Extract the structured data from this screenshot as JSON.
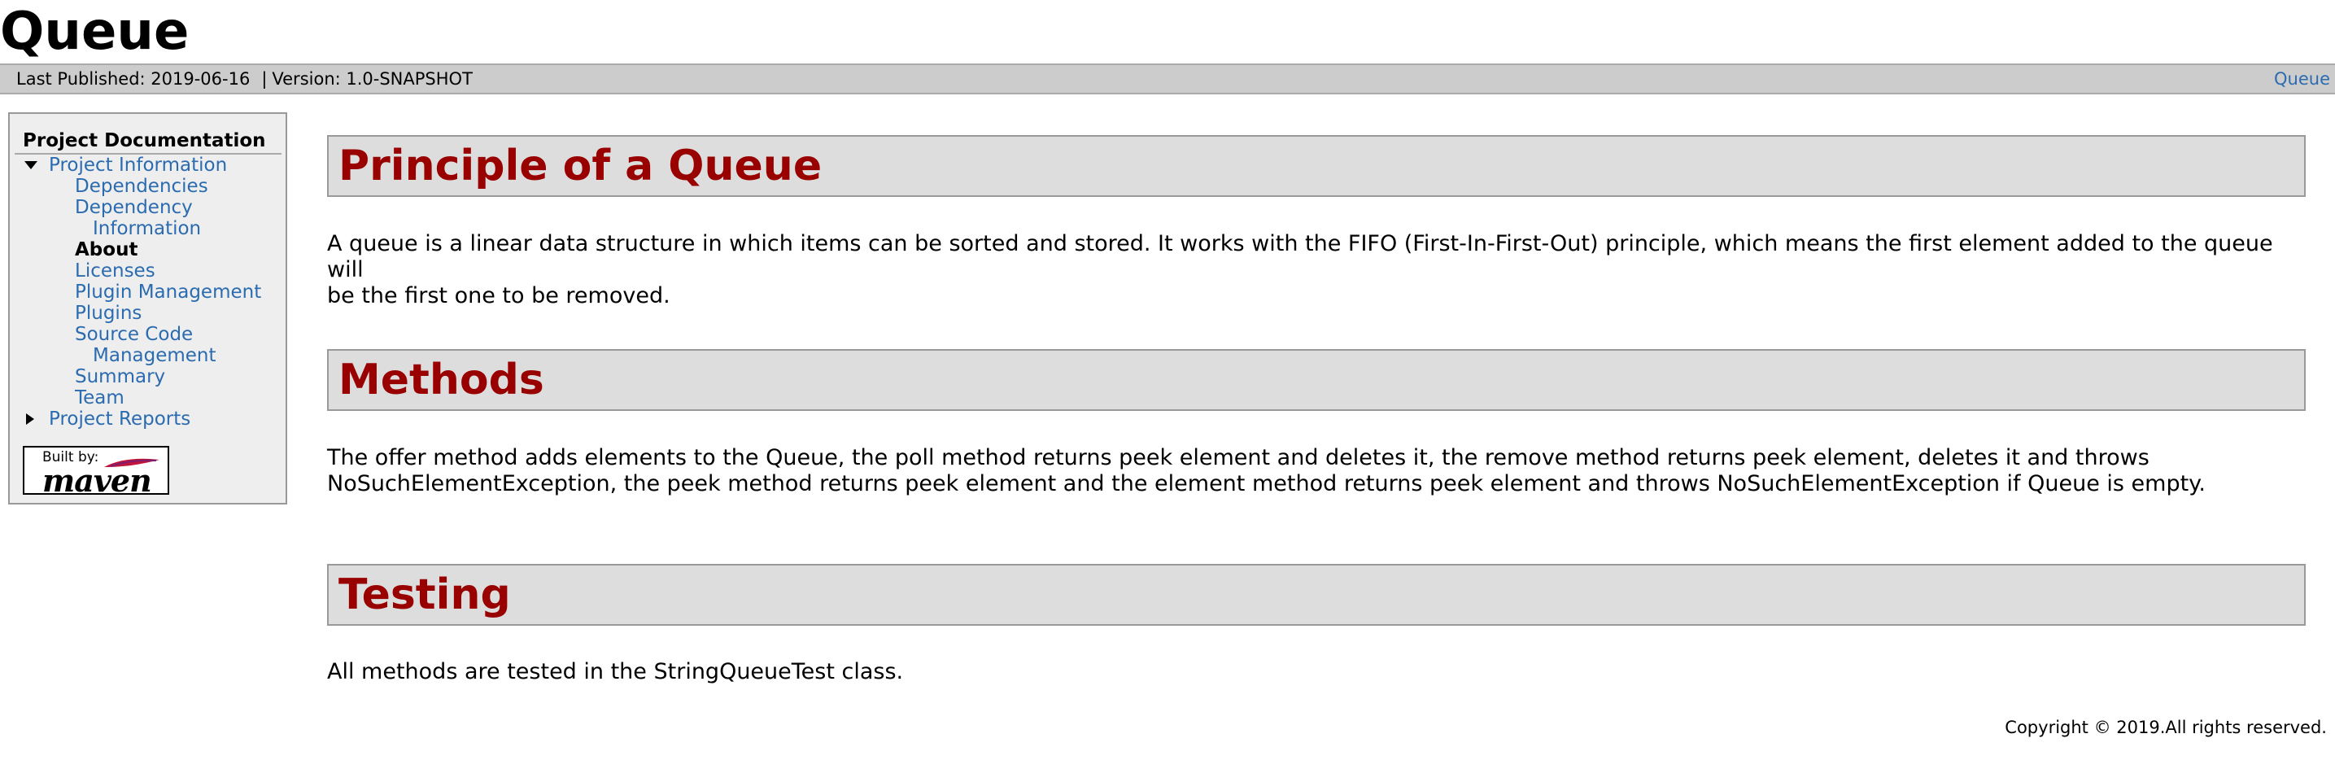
{
  "banner": {
    "title": "Queue"
  },
  "breadcrumbs": {
    "last_published": "Last Published: 2019-06-16",
    "separator": "|",
    "version": "Version: 1.0-SNAPSHOT",
    "right_link": "Queue"
  },
  "nav": {
    "heading": "Project Documentation",
    "items": [
      {
        "label": "Project Information"
      },
      {
        "label": "Dependencies"
      },
      {
        "label": "Dependency"
      },
      {
        "label": "Information"
      },
      {
        "label": "About"
      },
      {
        "label": "Licenses"
      },
      {
        "label": "Plugin Management"
      },
      {
        "label": "Plugins"
      },
      {
        "label": "Source Code"
      },
      {
        "label": "Management"
      },
      {
        "label": "Summary"
      },
      {
        "label": "Team"
      },
      {
        "label": "Project Reports"
      }
    ],
    "powered_by": {
      "built": "Built by:",
      "name": "maven"
    }
  },
  "content": {
    "sections": [
      {
        "heading": "Principle of a Queue",
        "body_line1": "A queue is a linear data structure in which items can be sorted and stored. It works with the FIFO (First-In-First-Out) principle, which means the first element added to the queue will",
        "body_line2": "be the first one to be removed."
      },
      {
        "heading": "Methods",
        "body_line1": "The offer method adds elements to the Queue, the poll method returns peek element and deletes it, the remove method returns peek element, deletes it and throws",
        "body_line2": "NoSuchElementException, the peek method returns peek element and the element method returns peek element and throws NoSuchElementException if Queue is empty."
      },
      {
        "heading": "Testing",
        "body_line1": "All methods are tested in the StringQueueTest class."
      }
    ]
  },
  "footer": {
    "copyright": "Copyright © 2019.All rights reserved."
  },
  "colors": {
    "heading_red": "#990000",
    "link_blue": "#2b6bb0",
    "bar_gray": "#cccccc"
  }
}
